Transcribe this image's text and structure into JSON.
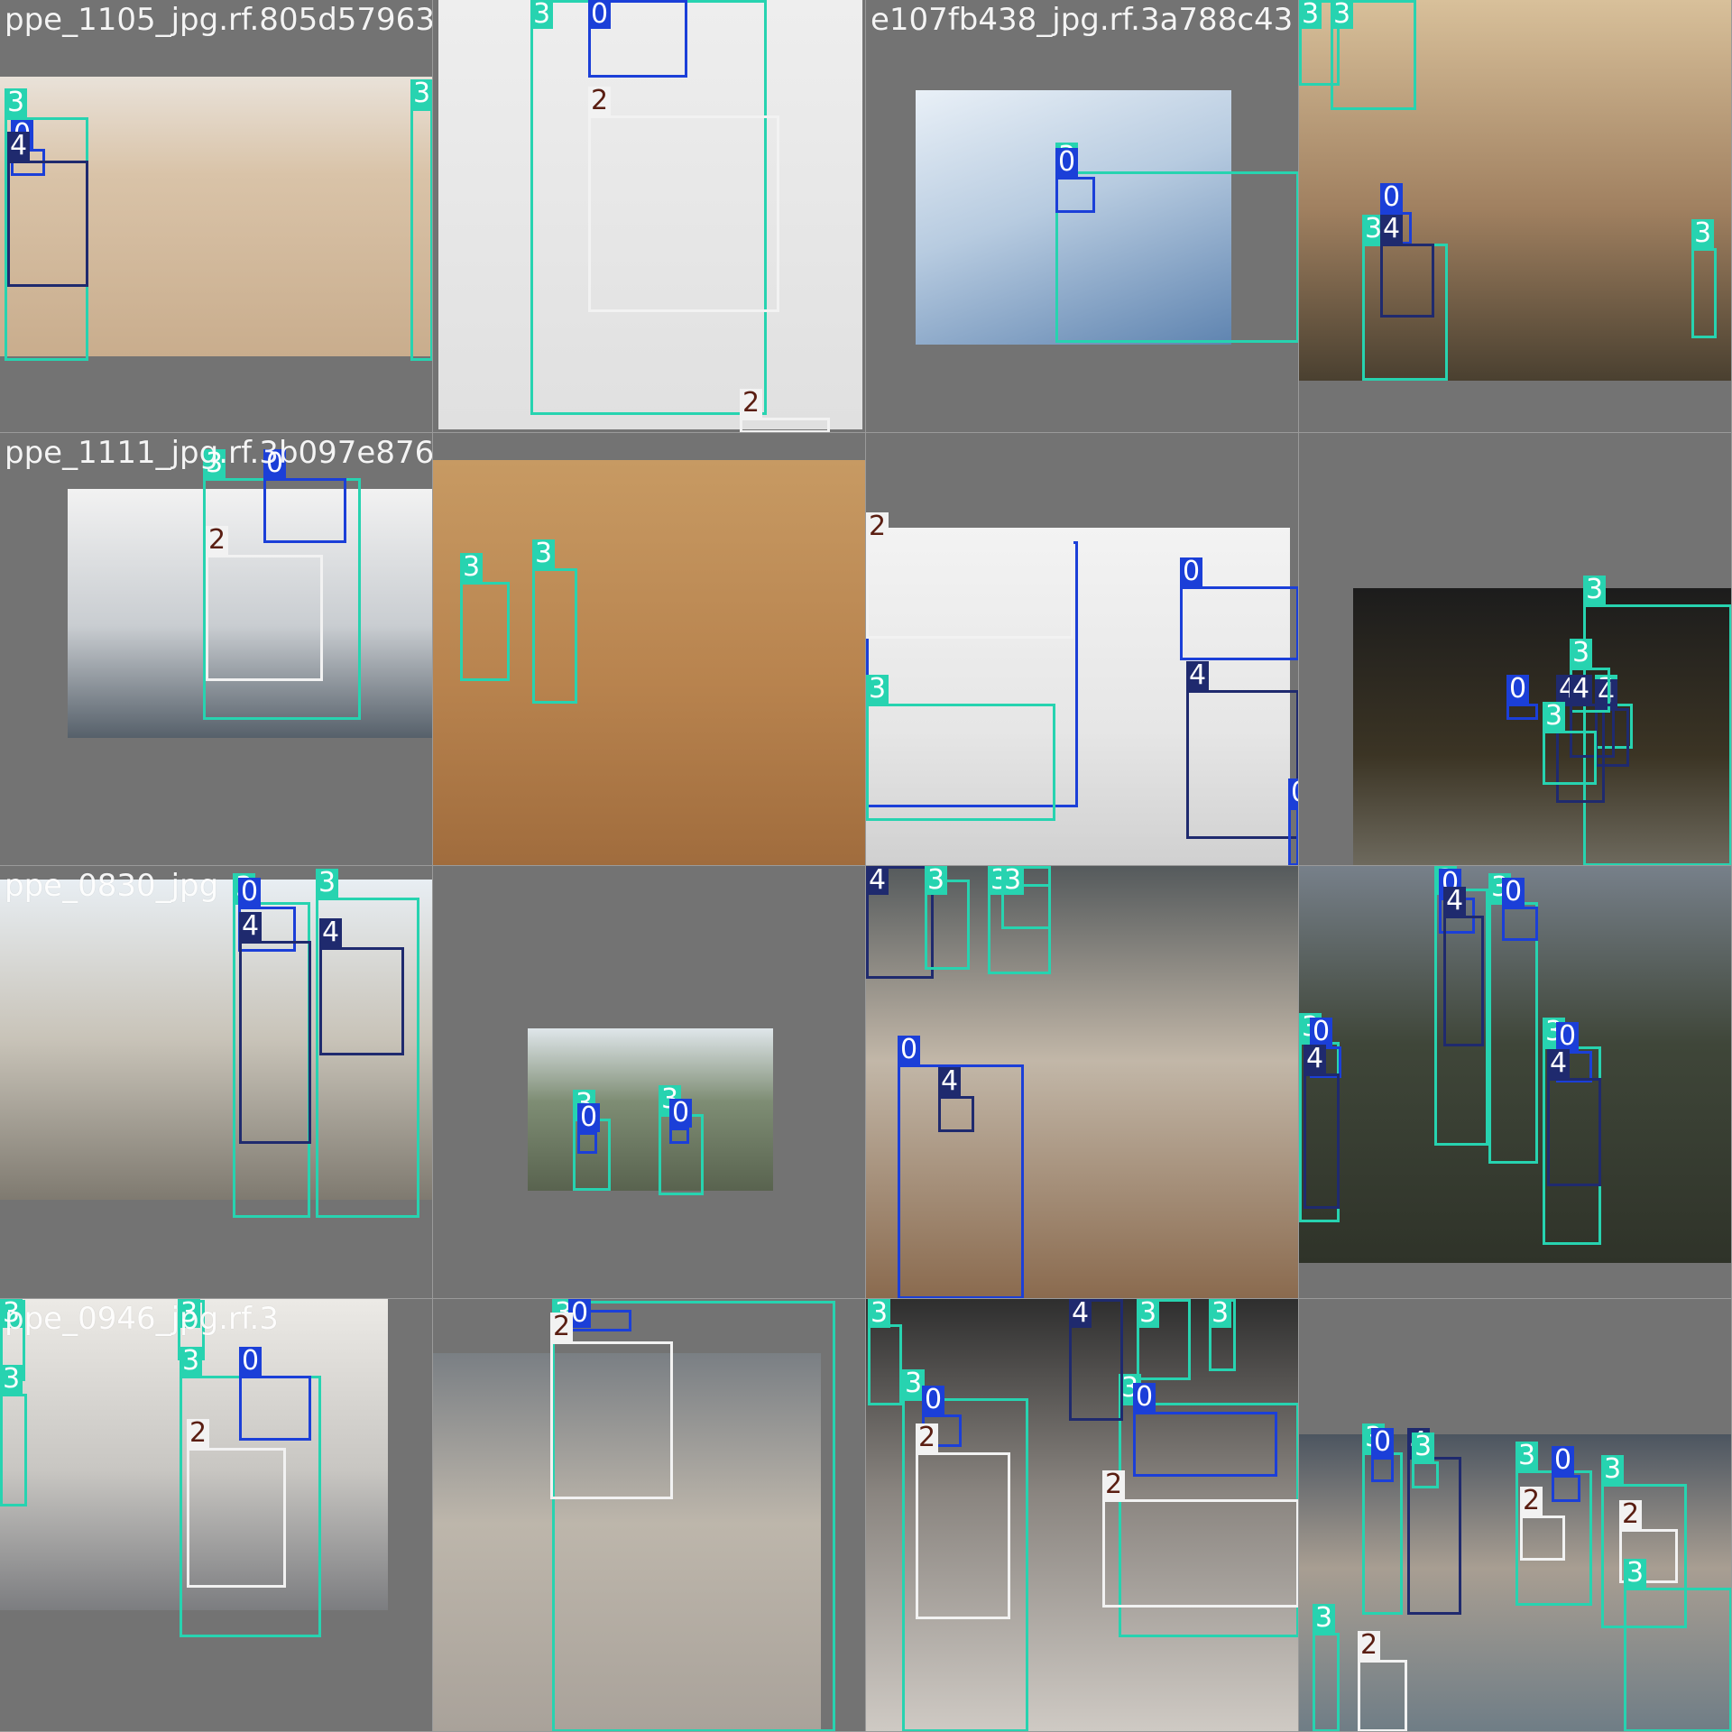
{
  "colors": {
    "0": "#1b3fd8",
    "2": "#f2f2f2",
    "3": "#27d3b0",
    "4": "#1f2a6e"
  },
  "label_text_colors": {
    "0": "#ffffff",
    "2": "#5a1e12",
    "3": "#ffffff",
    "4": "#ffffff"
  },
  "tiles": [
    {
      "caption": "ppe_1105_jpg.rf.805d57963",
      "boxes": [
        {
          "c": "3"
        },
        {
          "c": "0"
        },
        {
          "c": "4"
        },
        {
          "c": "3"
        }
      ]
    },
    {
      "caption": "",
      "boxes": [
        {
          "c": "3"
        },
        {
          "c": "0"
        },
        {
          "c": "2"
        },
        {
          "c": "2"
        }
      ]
    },
    {
      "caption": "e107fb438_jpg.rf.3a788c43",
      "boxes": [
        {
          "c": "3"
        },
        {
          "c": "0"
        }
      ]
    },
    {
      "caption": "",
      "boxes": [
        {
          "c": "3"
        },
        {
          "c": "3"
        },
        {
          "c": "3"
        },
        {
          "c": "0"
        },
        {
          "c": "4"
        },
        {
          "c": "3"
        }
      ]
    },
    {
      "caption": "ppe_1111_jpg.rf.3b097e876",
      "boxes": [
        {
          "c": "3"
        },
        {
          "c": "0"
        },
        {
          "c": "2"
        }
      ]
    },
    {
      "caption": "",
      "boxes": [
        {
          "c": "3"
        },
        {
          "c": "3"
        }
      ]
    },
    {
      "caption": "",
      "boxes": [
        {
          "c": "0"
        },
        {
          "c": "2"
        },
        {
          "c": "3"
        },
        {
          "c": "0"
        },
        {
          "c": "4"
        },
        {
          "c": "0"
        }
      ]
    },
    {
      "caption": "",
      "boxes": [
        {
          "c": "3"
        },
        {
          "c": "3"
        },
        {
          "c": "4"
        },
        {
          "c": "3"
        },
        {
          "c": "4"
        },
        {
          "c": "3"
        },
        {
          "c": "4"
        },
        {
          "c": "3"
        },
        {
          "c": "0"
        }
      ]
    },
    {
      "caption": "ppe_0830_jpg",
      "boxes": [
        {
          "c": "3"
        },
        {
          "c": "0"
        },
        {
          "c": "4"
        },
        {
          "c": "3"
        },
        {
          "c": "4"
        }
      ]
    },
    {
      "caption": "",
      "boxes": [
        {
          "c": "3"
        },
        {
          "c": "0"
        },
        {
          "c": "3"
        },
        {
          "c": "0"
        }
      ]
    },
    {
      "caption": "",
      "boxes": [
        {
          "c": "4"
        },
        {
          "c": "3"
        },
        {
          "c": "3"
        },
        {
          "c": "3"
        },
        {
          "c": "0"
        },
        {
          "c": "4"
        }
      ]
    },
    {
      "caption": "",
      "boxes": [
        {
          "c": "3"
        },
        {
          "c": "0"
        },
        {
          "c": "4"
        },
        {
          "c": "3"
        },
        {
          "c": "0"
        },
        {
          "c": "3"
        },
        {
          "c": "0"
        },
        {
          "c": "4"
        },
        {
          "c": "3"
        },
        {
          "c": "0"
        },
        {
          "c": "4"
        }
      ]
    },
    {
      "caption": "ppe_0946_jpg.rf.3",
      "boxes": [
        {
          "c": "3"
        },
        {
          "c": "3"
        },
        {
          "c": "3"
        },
        {
          "c": "0"
        },
        {
          "c": "2"
        },
        {
          "c": "3"
        }
      ]
    },
    {
      "caption": "",
      "boxes": [
        {
          "c": "3"
        },
        {
          "c": "0"
        },
        {
          "c": "2"
        }
      ]
    },
    {
      "caption": "",
      "boxes": [
        {
          "c": "3"
        },
        {
          "c": "3"
        },
        {
          "c": "0"
        },
        {
          "c": "2"
        },
        {
          "c": "3"
        },
        {
          "c": "0"
        },
        {
          "c": "2"
        },
        {
          "c": "4"
        },
        {
          "c": "3"
        },
        {
          "c": "3"
        }
      ]
    },
    {
      "caption": "",
      "boxes": [
        {
          "c": "3"
        },
        {
          "c": "0"
        },
        {
          "c": "4"
        },
        {
          "c": "3"
        },
        {
          "c": "3"
        },
        {
          "c": "0"
        },
        {
          "c": "2"
        },
        {
          "c": "3"
        },
        {
          "c": "2"
        },
        {
          "c": "3"
        },
        {
          "c": "2"
        },
        {
          "c": "3"
        }
      ]
    }
  ]
}
